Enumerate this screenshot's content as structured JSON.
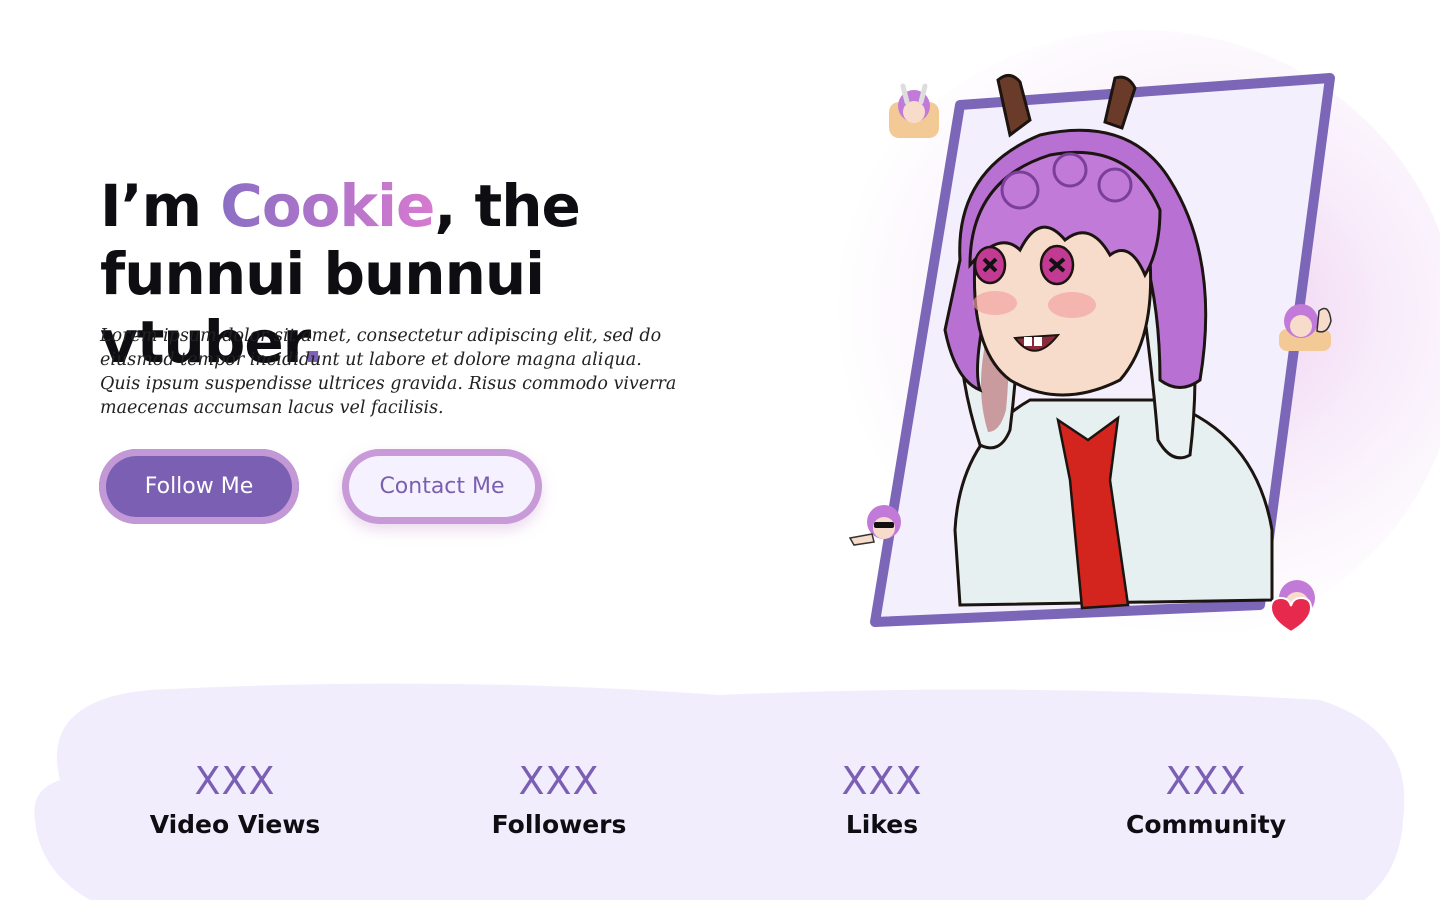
{
  "hero": {
    "headline_prefix": "I’m ",
    "headline_accent": "Cookie",
    "headline_suffix": ", the funnui bunnui vtuber",
    "headline_dot": ".",
    "description": "Lorem ipsum dolor sit amet, consectetur adipiscing elit, sed do eiusmod tempor incididunt ut labore et dolore magna aliqua. Quis ipsum suspendisse ultrices gravida. Risus commodo viverra maecenas accumsan lacus vel facilisis.",
    "buttons": {
      "follow_label": "Follow Me",
      "contact_label": "Contact Me"
    }
  },
  "stats": [
    {
      "value": "XXX",
      "label": "Video Views"
    },
    {
      "value": "XXX",
      "label": "Followers"
    },
    {
      "value": "XXX",
      "label": "Likes"
    },
    {
      "value": "XXX",
      "label": "Community"
    }
  ],
  "colors": {
    "accent": "#7b5fb3",
    "accent_light": "#c298d6",
    "band": "#f1edfd",
    "pink": "#d67ad0"
  }
}
